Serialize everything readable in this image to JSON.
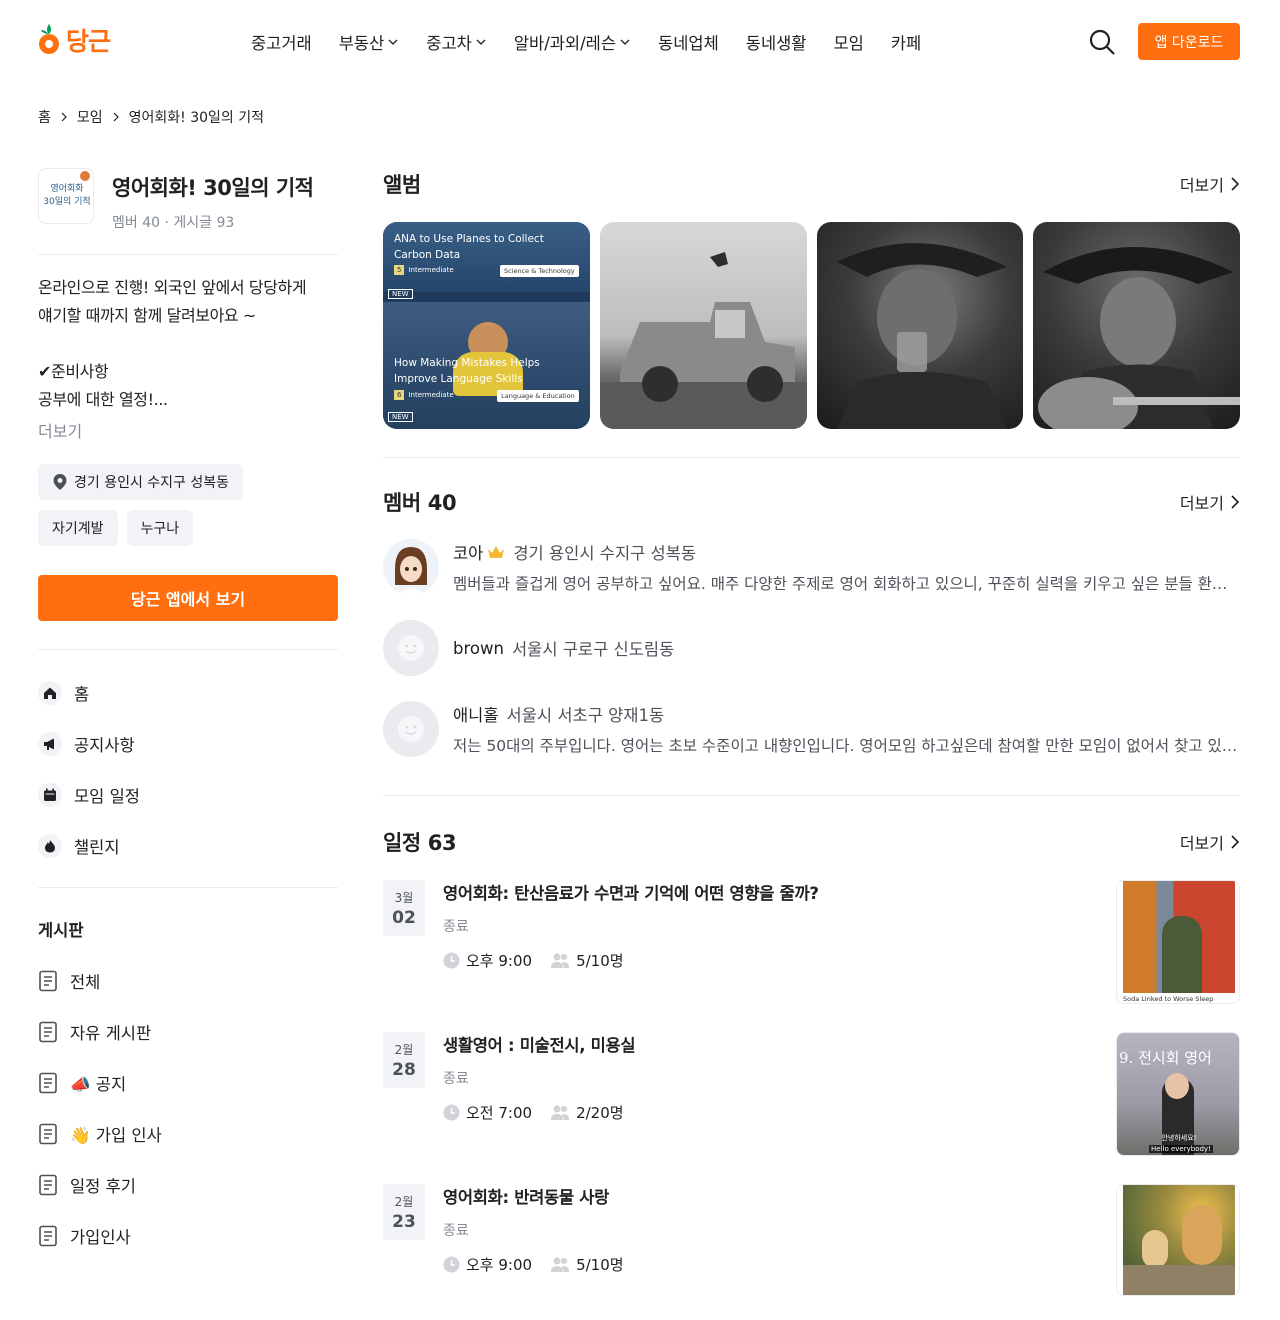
{
  "header": {
    "logo_text": "당근",
    "nav": [
      {
        "label": "중고거래",
        "dropdown": false
      },
      {
        "label": "부동산",
        "dropdown": true
      },
      {
        "label": "중고차",
        "dropdown": true
      },
      {
        "label": "알바/과외/레슨",
        "dropdown": true
      },
      {
        "label": "동네업체",
        "dropdown": false
      },
      {
        "label": "동네생활",
        "dropdown": false
      },
      {
        "label": "모임",
        "dropdown": false
      },
      {
        "label": "카페",
        "dropdown": false
      }
    ],
    "download_label": "앱 다운로드",
    "accent": "#ff6f0f"
  },
  "breadcrumb": [
    "홈",
    "모임",
    "영어회화! 30일의 기적"
  ],
  "group": {
    "thumb_text_1": "영어회화",
    "thumb_text_2": "30일의 기적",
    "title": "영어회화! 30일의 기적",
    "meta": "멤버 40 · 게시글 93",
    "description": "온라인으로 진행! 외국인 앞에서 당당하게\n얘기할 때까지 함께 달려보아요 ~\n\n✔준비사항\n공부에 대한 열정!...",
    "more": "더보기",
    "location": "경기 용인시 수지구 성복동",
    "tags": [
      "자기계발",
      "누구나"
    ],
    "app_button": "당근 앱에서 보기"
  },
  "menu": [
    {
      "label": "홈",
      "icon": "home-icon"
    },
    {
      "label": "공지사항",
      "icon": "megaphone-icon"
    },
    {
      "label": "모임 일정",
      "icon": "calendar-icon"
    },
    {
      "label": "챌린지",
      "icon": "fire-icon"
    }
  ],
  "board": {
    "title": "게시판",
    "items": [
      "전체",
      "자유 게시판",
      "📣 공지",
      "👋 가입 인사",
      "일정 후기",
      "가입인사"
    ]
  },
  "album": {
    "title": "앨범",
    "more": "더보기",
    "card1": {
      "headline1": "ANA to Use Planes to Collect",
      "headline2": "Carbon Data",
      "level1": "5",
      "level_label1": "Intermediate",
      "category1": "Science & Technology",
      "new": "NEW",
      "headline3": "How Making Mistakes Helps",
      "headline4": "Improve Language Skills",
      "level2": "6",
      "level_label2": "Intermediate",
      "category2": "Language & Education"
    }
  },
  "members": {
    "title": "멤버 40",
    "more": "더보기",
    "list": [
      {
        "name": "코아",
        "crown": true,
        "location": "경기 용인시 수지구 성복동",
        "bio": "멤버들과 즐겁게 영어 공부하고 싶어요.  매주 다양한 주제로 영어 회화하고 있으니, 꾸준히 실력을 키우고 싶은 분들 환영합니다."
      },
      {
        "name": "brown",
        "crown": false,
        "location": "서울시 구로구 신도림동",
        "bio": ""
      },
      {
        "name": "애니홀",
        "crown": false,
        "location": "서울시 서초구 양재1동",
        "bio": "저는 50대의 주부입니다. 영어는 초보 수준이고 내향인입니다. 영어모임 하고싶은데 참여할 만한 모임이 없어서 찾고 있어요."
      }
    ]
  },
  "events": {
    "title": "일정 63",
    "more": "더보기",
    "list": [
      {
        "month": "3월",
        "day": "02",
        "title": "영어회화: 탄산음료가 수면과 기억에 어떤 영향을 줄까?",
        "status": "종료",
        "time": "오후 9:00",
        "count": "5/10명",
        "thumb_caption": "Soda Linked to Worse Sleep"
      },
      {
        "month": "2월",
        "day": "28",
        "title": "생활영어 : 미술전시, 미용실",
        "status": "종료",
        "time": "오전 7:00",
        "count": "2/20명",
        "thumb_caption": "9. 전시회 영어",
        "thumb_sub": "안녕하세요!",
        "thumb_sub2": "Hello everybody!"
      },
      {
        "month": "2월",
        "day": "23",
        "title": "영어회화: 반려동물 사랑",
        "status": "종료",
        "time": "오후 9:00",
        "count": "5/10명",
        "thumb_caption": ""
      }
    ]
  }
}
